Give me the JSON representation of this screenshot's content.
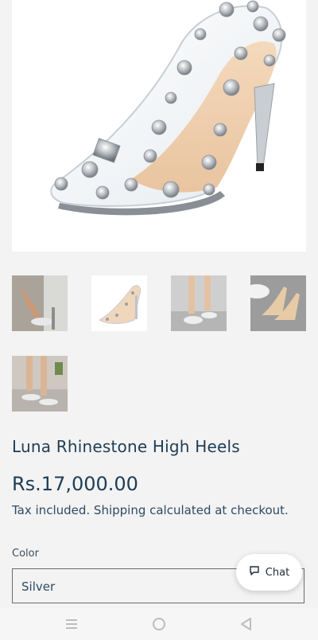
{
  "product": {
    "title": "Luna Rhinestone High Heels",
    "price": "Rs.17,000.00",
    "tax_note": "Tax included. Shipping calculated at checkout."
  },
  "variant": {
    "label": "Color",
    "selected": "Silver"
  },
  "chat": {
    "label": "Chat",
    "icon": "chat-bubble-icon"
  },
  "media": {
    "main_image": "clear-pvc-rhinestone-stiletto-heel",
    "thumbnails": [
      {
        "name": "thumb-1"
      },
      {
        "name": "thumb-2"
      },
      {
        "name": "thumb-3"
      },
      {
        "name": "thumb-4"
      },
      {
        "name": "thumb-5"
      }
    ]
  },
  "system_nav": {
    "items": [
      "menu-icon",
      "home-icon",
      "back-icon"
    ]
  },
  "colors": {
    "text_primary": "#1f3d55",
    "background": "#f3f3f3"
  }
}
